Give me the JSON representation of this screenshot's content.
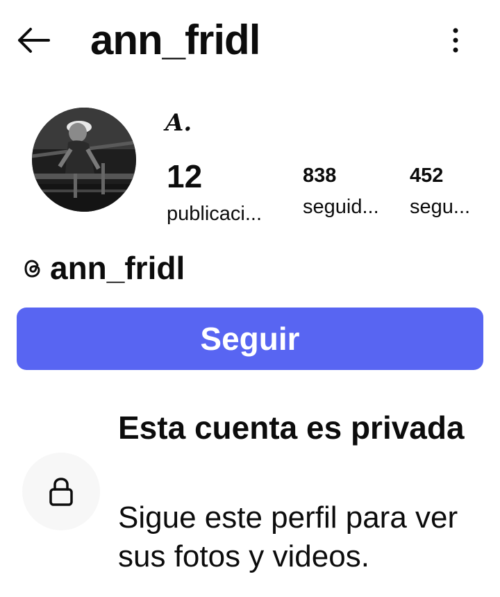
{
  "header": {
    "back_icon": "arrow-left-icon",
    "username": "ann_fridl",
    "more_icon": "vertical-dots-icon"
  },
  "profile": {
    "avatar_icon": "profile-photo",
    "bio_glyph": "A.",
    "stats": {
      "posts": {
        "count": "12",
        "label": "publicaci..."
      },
      "followers": {
        "count": "838",
        "label": "seguid..."
      },
      "following": {
        "count": "452",
        "label": "segu..."
      }
    }
  },
  "threads": {
    "icon": "threads-icon",
    "handle": "ann_fridl"
  },
  "actions": {
    "follow_label": "Seguir",
    "follow_color": "#5865f2"
  },
  "private_notice": {
    "icon": "lock-icon",
    "title": "Esta cuenta es privada",
    "subtitle": "Sigue este perfil para ver sus fotos y videos."
  }
}
